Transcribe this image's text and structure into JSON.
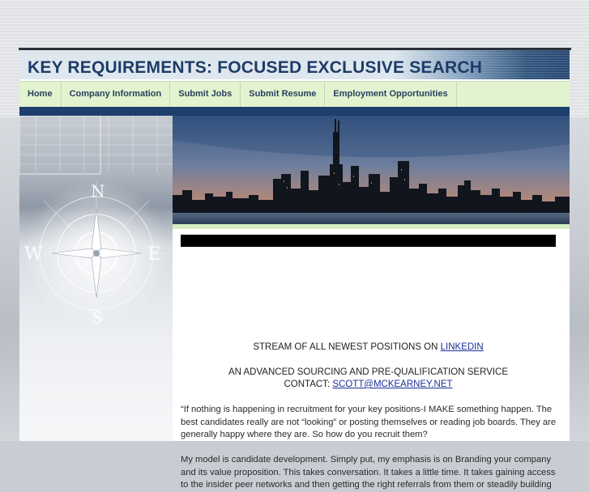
{
  "header": {
    "title": "KEY REQUIREMENTS: FOCUSED EXCLUSIVE SEARCH"
  },
  "nav": {
    "items": [
      {
        "label": "Home"
      },
      {
        "label": "Company Information"
      },
      {
        "label": "Submit Jobs"
      },
      {
        "label": "Submit Resume"
      },
      {
        "label": "Employment Opportunities"
      }
    ]
  },
  "compass": {
    "letters": {
      "north": "N",
      "west": "W",
      "east": "E",
      "south": "S"
    }
  },
  "content": {
    "stream_text": "STREAM OF ALL NEWEST POSITIONS ON ",
    "stream_link": "LINKEDIN",
    "service_text": "AN ADVANCED SOURCING AND PRE-QUALIFICATION SERVICE",
    "contact_label": "CONTACT:  ",
    "contact_email": "SCOTT@MCKEARNEY.NET",
    "paragraph1": "“If nothing is happening in recruitment for your key positions-I MAKE something happen. The best candidates really are not “looking” or posting themselves or reading job boards. They are generally happy where they are. So how do you recruit them?",
    "paragraph2": "My model is candidate development. Simply put, my emphasis is on Branding your company and its value proposition. This takes conversation. It takes a little time. It takes gaining access to the insider peer networks and then getting the right referrals from them or steadily building"
  },
  "colors": {
    "title": "#1d3c68",
    "nav_bg": "#e2f4cf",
    "navy": "#1e3f6d",
    "link": "#1a2f9a"
  }
}
